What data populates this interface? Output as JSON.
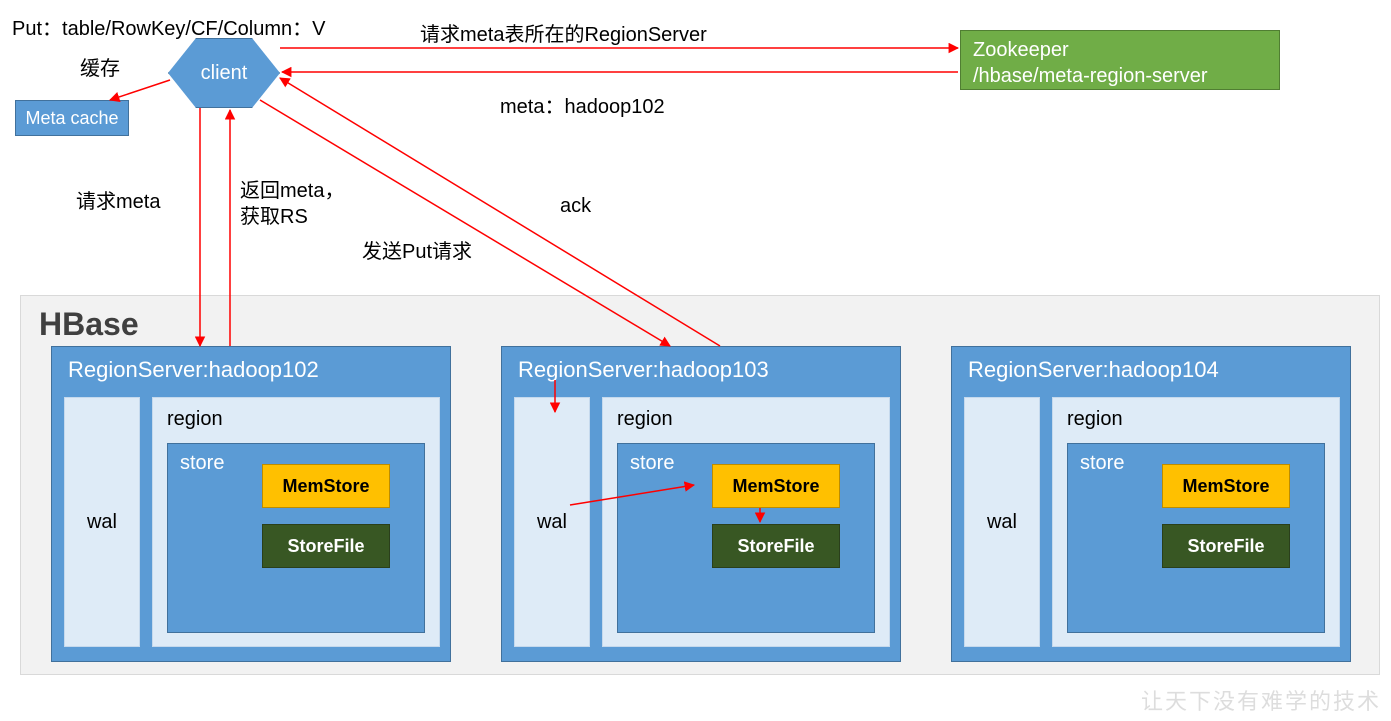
{
  "top": {
    "put_label": "Put：table/RowKey/CF/Column：V",
    "req_meta_rs": "请求meta表所在的RegionServer",
    "meta_return": "meta：hadoop102",
    "cache_label": "缓存",
    "req_meta": "请求meta",
    "return_meta": "返回meta，\n获取RS",
    "send_put": "发送Put请求",
    "ack": "ack"
  },
  "client": {
    "label": "client"
  },
  "metacache": {
    "label": "Meta cache"
  },
  "zookeeper": {
    "line1": "Zookeeper",
    "line2": "/hbase/meta-region-server"
  },
  "hbase": {
    "title": "HBase",
    "servers": [
      {
        "title": "RegionServer:hadoop102",
        "wal": "wal",
        "region": "region",
        "store": "store",
        "mem": "MemStore",
        "file": "StoreFile"
      },
      {
        "title": "RegionServer:hadoop103",
        "wal": "wal",
        "region": "region",
        "store": "store",
        "mem": "MemStore",
        "file": "StoreFile"
      },
      {
        "title": "RegionServer:hadoop104",
        "wal": "wal",
        "region": "region",
        "store": "store",
        "mem": "MemStore",
        "file": "StoreFile"
      }
    ]
  },
  "watermark": "让天下没有难学的技术"
}
